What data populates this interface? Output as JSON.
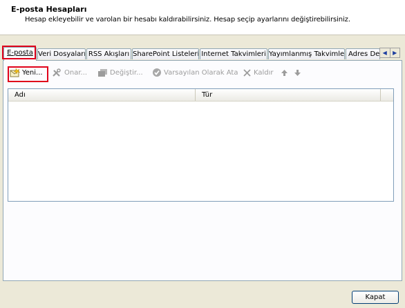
{
  "header": {
    "title": "E-posta Hesapları",
    "description": "Hesap ekleyebilir ve varolan bir hesabı kaldırabilirsiniz. Hesap seçip ayarlarını değiştirebilirsiniz."
  },
  "tabs": [
    {
      "label": "E-posta",
      "active": true
    },
    {
      "label": "Veri Dosyaları"
    },
    {
      "label": "RSS Akışları"
    },
    {
      "label": "SharePoint Listeleri"
    },
    {
      "label": "Internet Takvimleri"
    },
    {
      "label": "Yayımlanmış Takvimler"
    },
    {
      "label": "Adres De"
    }
  ],
  "toolbar": {
    "new_label": "Yeni...",
    "repair_label": "Onar...",
    "change_label": "Değiştir...",
    "set_default_label": "Varsayılan Olarak Ata",
    "remove_label": "Kaldır"
  },
  "list": {
    "columns": [
      "Adı",
      "Tür"
    ]
  },
  "footer": {
    "close_label": "Kapat"
  },
  "colors": {
    "highlight": "#e0001a",
    "dialog_bg": "#ece9d8"
  }
}
